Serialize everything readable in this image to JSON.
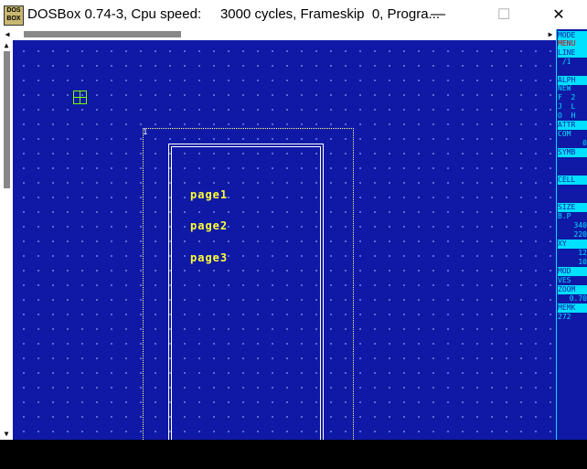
{
  "window": {
    "title": "DOSBox 0.74-3, Cpu speed:     3000 cycles, Frameskip  0, Progra...",
    "icon_text": "DOS BOX",
    "minimize": "—",
    "maximize": "☐",
    "close": "✕"
  },
  "canvas": {
    "page_number": "1",
    "menu_items": [
      "page1",
      "page2",
      "page3"
    ]
  },
  "sidebar": {
    "items": [
      {
        "label": "MODE",
        "style": "hl"
      },
      {
        "label": "MENU",
        "style": "red"
      },
      {
        "label": "LINE",
        "style": "hl"
      },
      {
        "label": " /1",
        "style": "plain"
      },
      {
        "label": "ALPH",
        "style": "hl"
      },
      {
        "label": "NEW",
        "style": "plain"
      },
      {
        "label": "F  2",
        "style": "plain"
      },
      {
        "label": "J  L",
        "style": "plain"
      },
      {
        "label": "O  H",
        "style": "plain"
      },
      {
        "label": "ATTR",
        "style": "hl"
      },
      {
        "label": "COM",
        "style": "plain"
      },
      {
        "label": "0",
        "style": "val"
      },
      {
        "label": "SYMB",
        "style": "hl"
      },
      {
        "label": "CELL",
        "style": "hl"
      },
      {
        "label": "SIZE",
        "style": "hl"
      },
      {
        "label": "B.P",
        "style": "plain"
      },
      {
        "label": "340",
        "style": "val"
      },
      {
        "label": "220",
        "style": "val"
      },
      {
        "label": "XY",
        "style": "hl"
      },
      {
        "label": "12",
        "style": "val"
      },
      {
        "label": "10",
        "style": "val"
      },
      {
        "label": "MOD",
        "style": "hl"
      },
      {
        "label": "VES",
        "style": "plain"
      },
      {
        "label": "ZOOM",
        "style": "hl"
      },
      {
        "label": "0.70",
        "style": "val"
      },
      {
        "label": "MEMK",
        "style": "hl"
      },
      {
        "label": "272",
        "style": "plain"
      }
    ]
  }
}
